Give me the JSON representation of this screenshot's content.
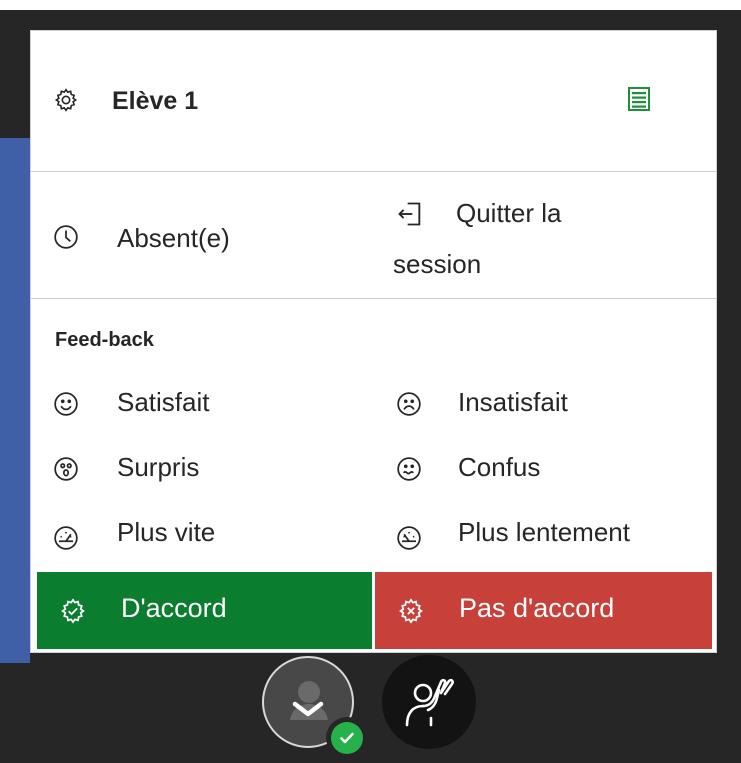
{
  "colors": {
    "accent_green": "#0b7d2e",
    "accent_red": "#c8403a",
    "list_icon_green": "#1f8f3a",
    "side_blue": "#3f5fa6",
    "dark_bg": "#262626"
  },
  "header": {
    "title": "Elève 1",
    "settings_icon": "gear-icon",
    "list_icon": "list-view-icon"
  },
  "status_options": [
    {
      "label": "Absent(e)",
      "icon": "clock-icon"
    },
    {
      "label_line1": "Quitter la",
      "label_line2": "session",
      "icon": "exit-icon"
    }
  ],
  "feedback": {
    "title": "Feed-back",
    "items": [
      {
        "label": "Satisfait",
        "icon": "smile-icon"
      },
      {
        "label": "Insatisfait",
        "icon": "frown-icon"
      },
      {
        "label": "Surpris",
        "icon": "surprised-icon"
      },
      {
        "label": "Confus",
        "icon": "confused-icon"
      },
      {
        "label": "Plus vite",
        "icon": "speed-fast-icon"
      },
      {
        "label": "Plus lentement",
        "icon": "speed-slow-icon"
      }
    ]
  },
  "actions": {
    "agree_label": "D'accord",
    "agree_icon": "check-badge-icon",
    "disagree_label": "Pas d'accord",
    "disagree_icon": "x-badge-icon"
  },
  "bottom_bar": {
    "status_button_icon": "user-chevron-icon",
    "status_badge_icon": "checkmark-icon",
    "raise_hand_icon": "raise-hand-icon"
  }
}
